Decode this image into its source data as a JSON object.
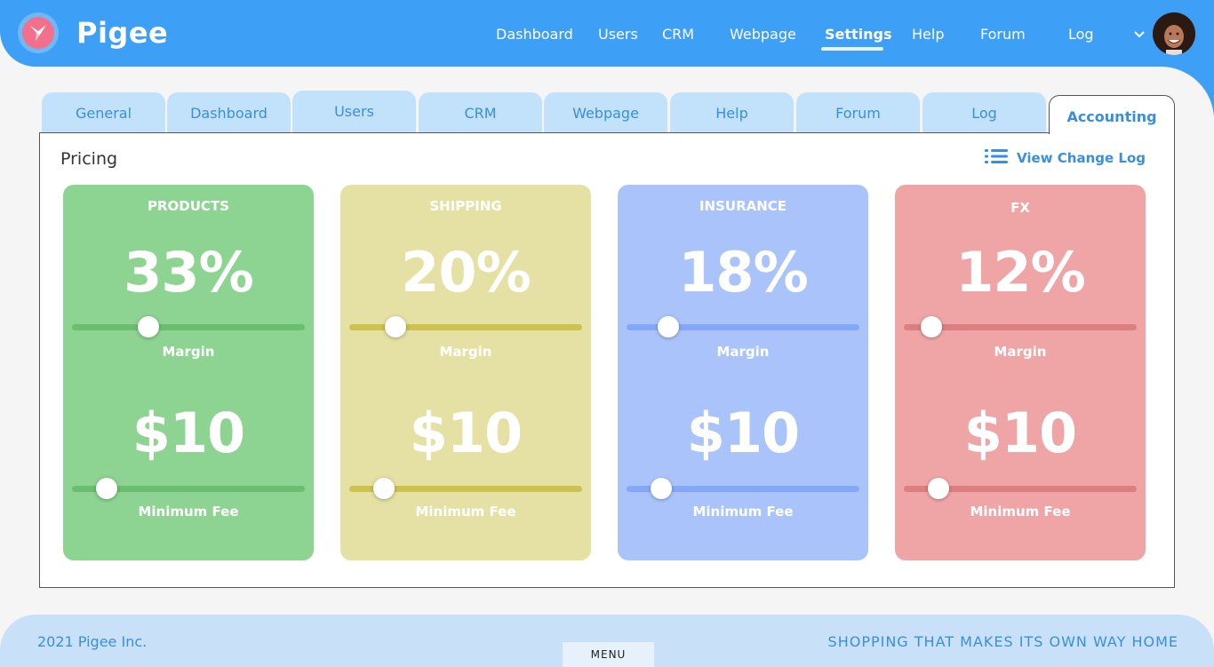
{
  "brand": "Pigee",
  "nav": [
    {
      "label": "Dashboard",
      "active": false
    },
    {
      "label": "Users",
      "active": false
    },
    {
      "label": "CRM",
      "active": false
    },
    {
      "label": "Webpage",
      "active": false
    },
    {
      "label": "Settings",
      "active": true
    },
    {
      "label": "Help",
      "active": false
    },
    {
      "label": "Forum",
      "active": false
    },
    {
      "label": "Log",
      "active": false
    }
  ],
  "tabs": [
    {
      "label": "General"
    },
    {
      "label": "Dashboard"
    },
    {
      "label": "Users"
    },
    {
      "label": "CRM"
    },
    {
      "label": "Webpage"
    },
    {
      "label": "Help"
    },
    {
      "label": "Forum"
    },
    {
      "label": "Log"
    },
    {
      "label": "Accounting",
      "active": true
    }
  ],
  "panel": {
    "title": "Pricing",
    "change_log_label": "View Change Log"
  },
  "cards": [
    {
      "title": "PRODUCTS",
      "margin": "33%",
      "margin_fraction": 0.33,
      "margin_label": "Margin",
      "fee": "$10",
      "fee_fraction": 0.15,
      "fee_label": "Minimum Fee",
      "bg": "#8dd391",
      "track": "#6bbd70"
    },
    {
      "title": "SHIPPING",
      "margin": "20%",
      "margin_fraction": 0.2,
      "margin_label": "Margin",
      "fee": "$10",
      "fee_fraction": 0.15,
      "fee_label": "Minimum Fee",
      "bg": "#e5e1a5",
      "track": "#cbc24f"
    },
    {
      "title": "INSURANCE",
      "margin": "18%",
      "margin_fraction": 0.18,
      "margin_label": "Margin",
      "fee": "$10",
      "fee_fraction": 0.15,
      "fee_label": "Minimum Fee",
      "bg": "#aac4fb",
      "track": "#84a8f8"
    },
    {
      "title": "FX",
      "margin": "12%",
      "margin_fraction": 0.12,
      "margin_label": "Margin",
      "fee": "$10",
      "fee_fraction": 0.15,
      "fee_label": "Minimum Fee",
      "bg": "#efa5a5",
      "track": "#db7f81"
    }
  ],
  "footer": {
    "copyright": "2021 Pigee Inc.",
    "menu": "MENU",
    "slogan": "SHOPPING THAT MAKES ITS OWN WAY HOME"
  },
  "icons": {
    "logo": "origami-bird-logo",
    "dropdown": "chevron-down-icon",
    "change_log": "list-icon"
  },
  "colors": {
    "header": "#3d9ff5",
    "accent": "#3a8fd9",
    "tab": "#c2e1fb",
    "footer": "#c9e1f8"
  }
}
